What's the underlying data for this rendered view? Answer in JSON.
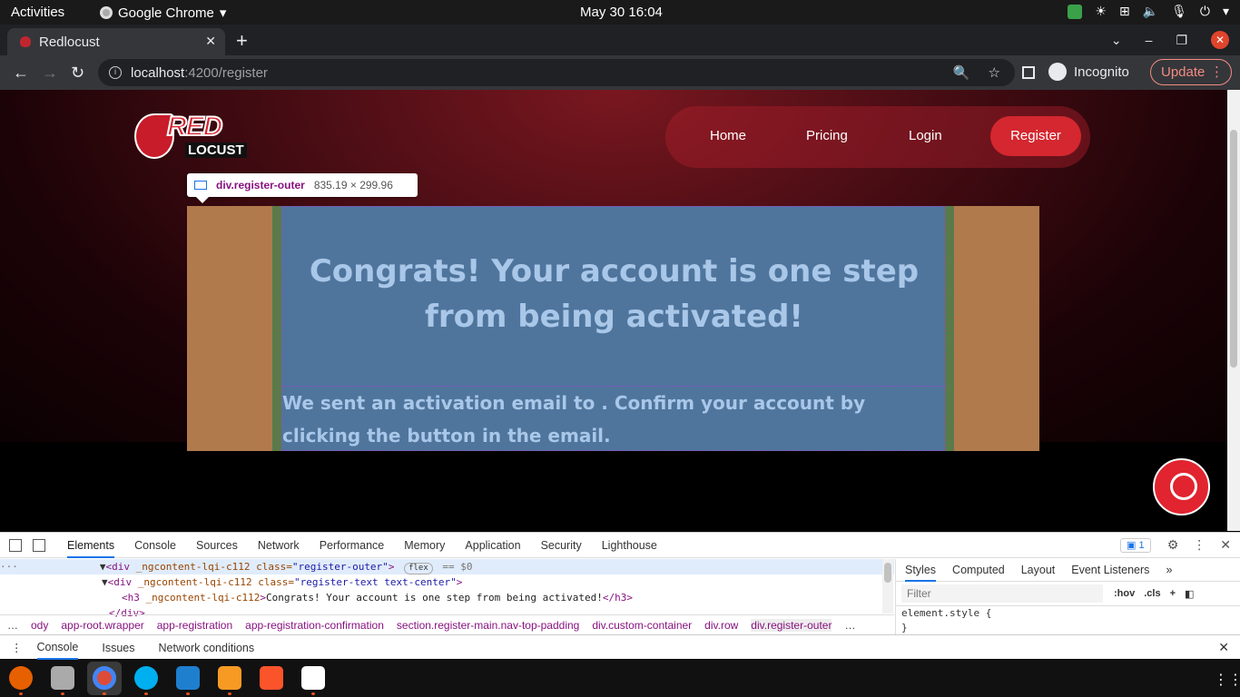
{
  "system_bar": {
    "activities": "Activities",
    "app_name": "Google Chrome",
    "clock": "May 30  16:04"
  },
  "browser": {
    "tab_title": "Redlocust",
    "url_host": "localhost",
    "url_path": ":4200/register",
    "incognito_label": "Incognito",
    "update_label": "Update"
  },
  "page": {
    "nav": {
      "home": "Home",
      "pricing": "Pricing",
      "login": "Login",
      "register": "Register"
    },
    "logo": {
      "top": "RED",
      "bottom": "LOCUST"
    },
    "heading": "Congrats! Your account is one step from being activated!",
    "message": "We sent an activation email to . Confirm your account by clicking the button in the email."
  },
  "inspector_tooltip": {
    "selector": "div.register-outer",
    "size": "835.19 × 299.96"
  },
  "devtools": {
    "tabs": [
      "Elements",
      "Console",
      "Sources",
      "Network",
      "Performance",
      "Memory",
      "Application",
      "Security",
      "Lighthouse"
    ],
    "active_tab": "Elements",
    "issues_count": "1",
    "dom_lines": {
      "line1_open": "<div",
      "line1_attr": "_ngcontent-lqi-c112",
      "line1_class_key": "class=",
      "line1_class_val": "\"register-outer\"",
      "line1_close": ">",
      "line1_badge": "flex",
      "line1_eq": "== $0",
      "line2_open": "<div",
      "line2_attr": "_ngcontent-lqi-c112",
      "line2_class_key": "class=",
      "line2_class_val": "\"register-text text-center\"",
      "line2_close": ">",
      "line3_open": "<h3",
      "line3_attr": "_ngcontent-lqi-c112",
      "line3_text": "Congrats! Your account is one step from being activated!",
      "line3_close": "</h3>",
      "line4": "</div>"
    },
    "breadcrumbs": [
      "ody",
      "app-root.wrapper",
      "app-registration",
      "app-registration-confirmation",
      "section.register-main.nav-top-padding",
      "div.custom-container",
      "div.row",
      "div.register-outer"
    ],
    "styles_tabs": [
      "Styles",
      "Computed",
      "Layout",
      "Event Listeners"
    ],
    "filter_placeholder": "Filter",
    "hov": ":hov",
    "cls": ".cls",
    "element_style": "element.style {",
    "element_style_close": "}",
    "drawer_tabs": [
      "Console",
      "Issues",
      "Network conditions"
    ]
  },
  "colors": {
    "brand_red": "#d4272f",
    "highlight_content": "#4f759d",
    "highlight_padding": "#5a7a4a",
    "highlight_margin": "#b07a4c"
  }
}
